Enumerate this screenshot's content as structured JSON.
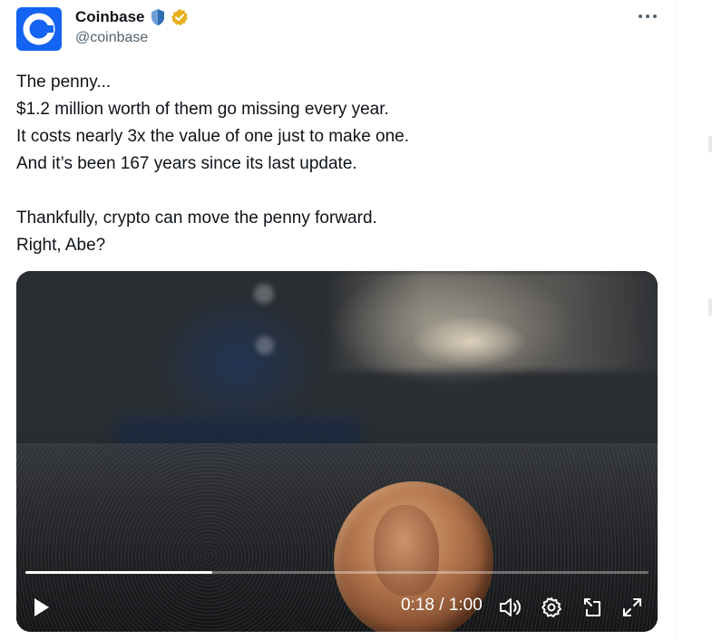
{
  "author": {
    "display_name": "Coinbase",
    "handle": "@coinbase",
    "badges": [
      "shield-icon",
      "verified-badge-icon"
    ],
    "brand_color": "#1463f3"
  },
  "tweet": {
    "lines": [
      "The penny...",
      "$1.2 million worth of them go missing every year.",
      "It costs nearly 3x the value of one just to make one.",
      "And it’s been 167 years since its last update.",
      "",
      "Thankfully, crypto can move the penny forward.",
      "Right, Abe?"
    ]
  },
  "video": {
    "elapsed": "0:18",
    "separator": " / ",
    "duration": "1:00",
    "progress_fraction": 0.3,
    "controls": [
      "play-icon",
      "volume-icon",
      "settings-icon",
      "pop-out-icon",
      "fullscreen-icon"
    ]
  }
}
